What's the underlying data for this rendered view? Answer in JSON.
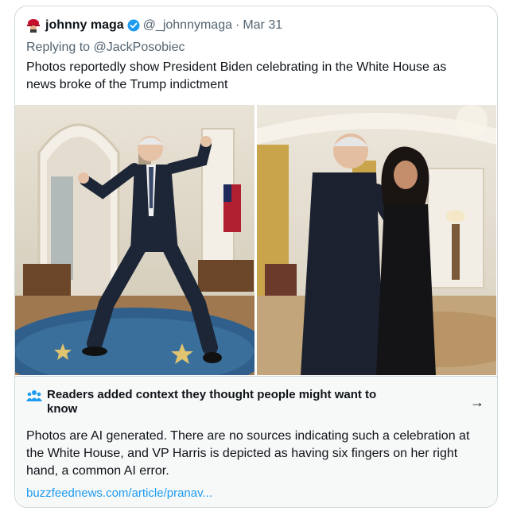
{
  "tweet": {
    "display_name": "johnny maga",
    "handle": "@_johnnymaga",
    "separator": "·",
    "date": "Mar 31",
    "replying_prefix": "Replying to",
    "replying_to": "@JackPosobiec",
    "text": "Photos reportedly show President Biden celebrating in the White House as news broke of the Trump indictment",
    "avatar_icon": "maga-hat-avatar-icon",
    "verified_icon": "verified-badge-icon",
    "verified_color": "#1d9bf0"
  },
  "media": {
    "images": [
      "photo-biden-dancing",
      "photo-biden-harris-hug"
    ]
  },
  "community_note": {
    "icon": "people-group-icon",
    "title": "Readers added context they thought people might want to know",
    "arrow": "→",
    "body": "Photos are AI generated. There are no sources indicating such a celebration at the White House, and VP Harris is depicted as having six fingers on her right hand, a common AI error.",
    "link": "buzzfeednews.com/article/pranav...",
    "link_color": "#1d9bf0",
    "background": "#f7f9f9"
  }
}
